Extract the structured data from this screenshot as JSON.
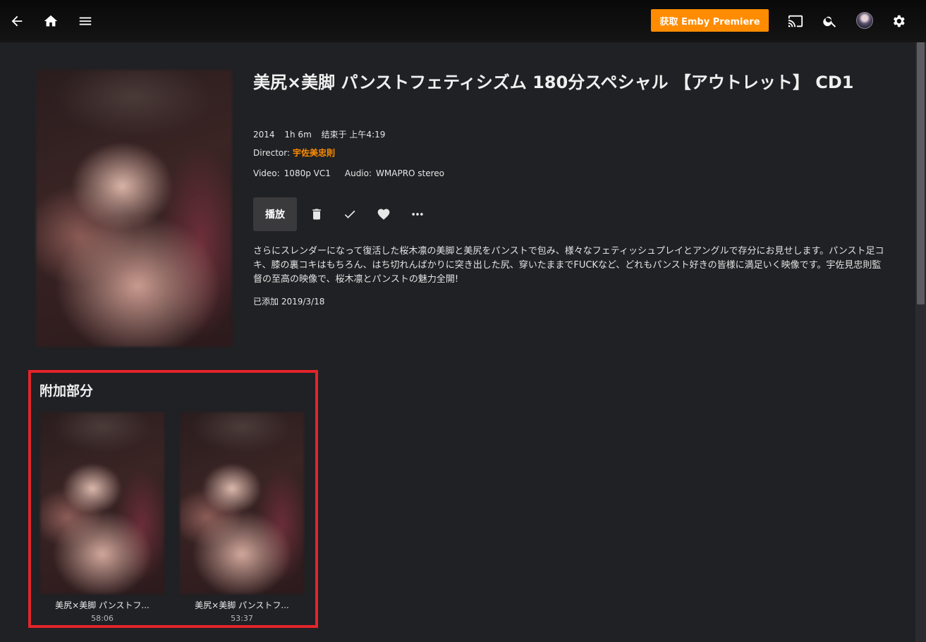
{
  "header": {
    "premiere_label": "获取 Emby Premiere",
    "icons": [
      "back-arrow-icon",
      "home-icon",
      "menu-icon",
      "cast-icon",
      "search-icon",
      "avatar",
      "gear-icon"
    ],
    "accent": "#ff8c00"
  },
  "item": {
    "title": "美尻×美脚 パンストフェティシズム 180分スペシャル 【アウトレット】 CD1",
    "year": "2014",
    "runtime": "1h 6m",
    "ends_at": "结束于 上午4:19",
    "director_label": "Director:",
    "director_name": "宇佐美忠則",
    "video_label": "Video:",
    "video_value": "1080p VC1",
    "audio_label": "Audio:",
    "audio_value": "WMAPRO stereo",
    "play_label": "播放",
    "overview": "さらにスレンダーになって復活した桜木凛の美脚と美尻をパンストで包み、様々なフェティッシュプレイとアングルで存分にお見せします。パンスト足コキ、膝の裏コキはもちろん、はち切れんばかりに突き出した尻、穿いたままでFUCKなど、どれもパンスト好きの皆様に満足いく映像です。宇佐見忠則監督の至高の映像で、桜木凛とパンストの魅力全開!",
    "added": "已添加 2019/3/18"
  },
  "extras": {
    "title": "附加部分",
    "highlight_color": "#e3242b",
    "items": [
      {
        "title": "美尻×美脚 パンストフ...",
        "duration": "58:06"
      },
      {
        "title": "美尻×美脚 パンストフ...",
        "duration": "53:37"
      }
    ]
  }
}
